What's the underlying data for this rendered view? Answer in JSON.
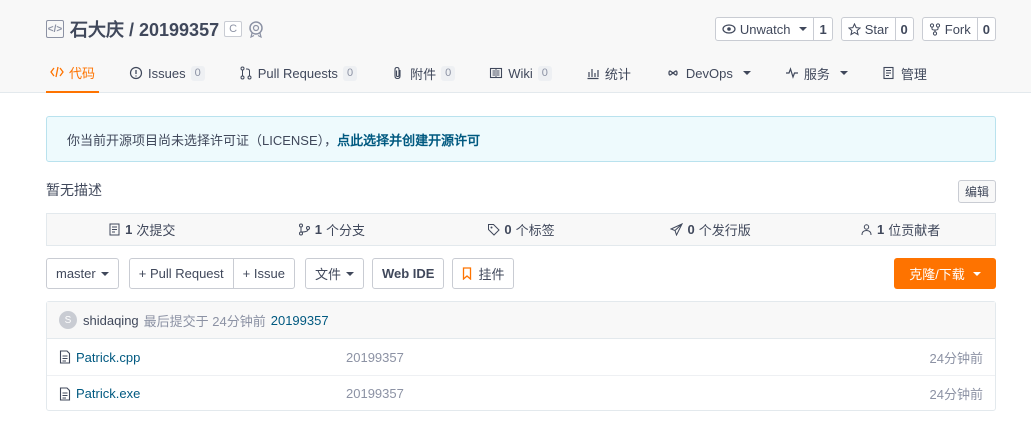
{
  "repo": {
    "title": "石大庆 / 20199357",
    "lang": "C",
    "icon_text": "</>"
  },
  "actions": {
    "watch": {
      "label": "Unwatch",
      "count": "1"
    },
    "star": {
      "label": "Star",
      "count": "0"
    },
    "fork": {
      "label": "Fork",
      "count": "0"
    }
  },
  "tabs": [
    {
      "label": "代码",
      "icon": "code-icon"
    },
    {
      "label": "Issues",
      "count": "0",
      "icon": "issue-icon"
    },
    {
      "label": "Pull Requests",
      "count": "0",
      "icon": "pull-request-icon"
    },
    {
      "label": "附件",
      "count": "0",
      "icon": "attachment-icon"
    },
    {
      "label": "Wiki",
      "count": "0",
      "icon": "wiki-icon"
    },
    {
      "label": "统计",
      "icon": "stats-icon"
    },
    {
      "label": "DevOps",
      "icon": "devops-icon"
    },
    {
      "label": "服务",
      "icon": "service-icon"
    },
    {
      "label": "管理",
      "icon": "manage-icon"
    }
  ],
  "notice": {
    "text": "你当前开源项目尚未选择许可证（LICENSE），",
    "link": "点此选择并创建开源许可"
  },
  "description": "暂无描述",
  "edit_label": "编辑",
  "stats": [
    {
      "count": "1",
      "label": "次提交"
    },
    {
      "count": "1",
      "label": "个分支"
    },
    {
      "count": "0",
      "label": "个标签"
    },
    {
      "count": "0",
      "label": "个发行版"
    },
    {
      "count": "1",
      "label": "位贡献者"
    }
  ],
  "toolbar": {
    "branch": "master",
    "pull_request": "+ Pull Request",
    "issue": "+ Issue",
    "file": "文件",
    "web_ide": "Web IDE",
    "pendant": "挂件",
    "clone": "克隆/下载"
  },
  "commit": {
    "avatar_letter": "S",
    "author": "shidaqing",
    "meta": "最后提交于 24分钟前",
    "message": "20199357"
  },
  "files": [
    {
      "name": "Patrick.cpp",
      "message": "20199357",
      "time": "24分钟前"
    },
    {
      "name": "Patrick.exe",
      "message": "20199357",
      "time": "24分钟前"
    }
  ],
  "colors": {
    "accent": "#fe7300",
    "link": "#005980",
    "notice_bg": "#eefafd"
  }
}
